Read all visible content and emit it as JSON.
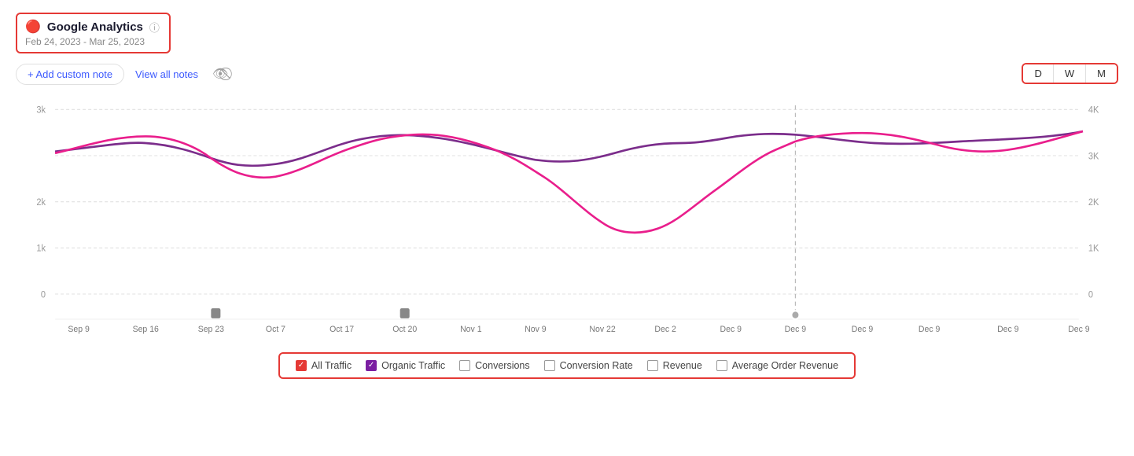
{
  "header": {
    "title": "Google Analytics",
    "date_range": "Feb 24, 2023 - Mar 25, 2023",
    "alert_icon": "⬤",
    "info_icon": "ℹ"
  },
  "toolbar": {
    "add_note_label": "+ Add custom note",
    "view_notes_label": "View all notes",
    "eye_icon": "eye-slash"
  },
  "period_switcher": {
    "buttons": [
      {
        "label": "D",
        "active": false
      },
      {
        "label": "W",
        "active": false
      },
      {
        "label": "M",
        "active": false
      }
    ]
  },
  "chart": {
    "y_axis_left": [
      "3k",
      "2k",
      "1k",
      "0"
    ],
    "y_axis_right": [
      "4K",
      "3K",
      "2K",
      "1K",
      "0"
    ],
    "x_axis": [
      "Sep 9",
      "Sep 16",
      "Sep 23",
      "Oct 7",
      "Oct 17",
      "Oct 20",
      "Nov 1",
      "Nov 9",
      "Nov 22",
      "Dec 2",
      "Dec 9",
      "Dec 9",
      "Dec 9",
      "Dec 9",
      "Dec 9"
    ]
  },
  "legend": {
    "items": [
      {
        "label": "All Traffic",
        "checked": true,
        "color": "red"
      },
      {
        "label": "Organic Traffic",
        "checked": true,
        "color": "purple"
      },
      {
        "label": "Conversions",
        "checked": false,
        "color": "none"
      },
      {
        "label": "Conversion Rate",
        "checked": false,
        "color": "none"
      },
      {
        "label": "Revenue",
        "checked": false,
        "color": "none"
      },
      {
        "label": "Average Order Revenue",
        "checked": false,
        "color": "none"
      }
    ]
  }
}
